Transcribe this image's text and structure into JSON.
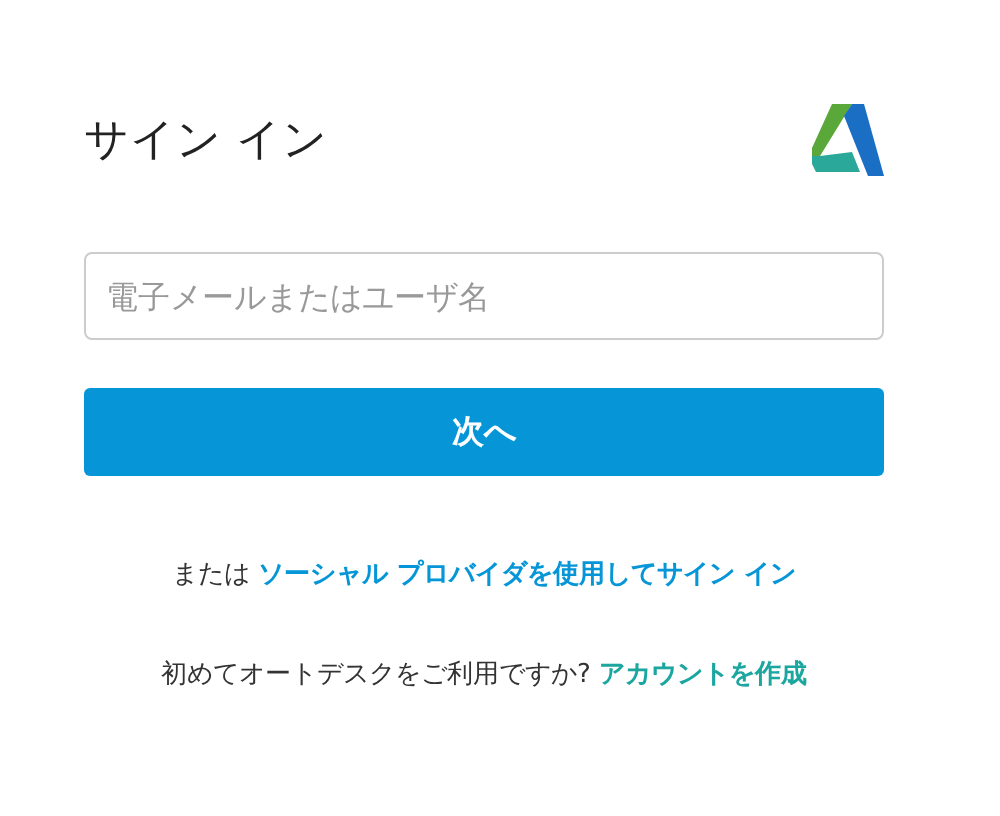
{
  "title": "サイン イン",
  "email_field": {
    "placeholder": "電子メールまたはユーザ名"
  },
  "next_button": "次へ",
  "social_line": {
    "text": "または",
    "link": "ソーシャル プロバイダを使用してサイン イン"
  },
  "signup_line": {
    "text": "初めてオートデスクをご利用ですか?",
    "link": "アカウントを作成"
  }
}
